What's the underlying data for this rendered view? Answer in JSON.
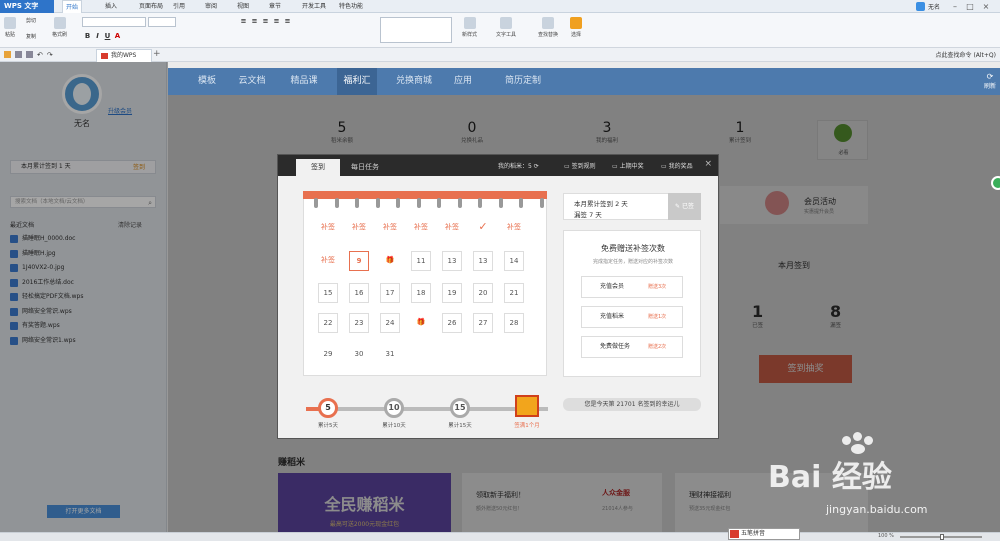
{
  "app": {
    "name": "WPS 文字"
  },
  "menu": [
    "开始",
    "插入",
    "页面布局",
    "引用",
    "审阅",
    "视图",
    "章节",
    "开发工具",
    "特色功能"
  ],
  "user_name_top": "无名",
  "ribbon": {
    "paste": "粘贴",
    "cut": "剪切",
    "copy": "复制",
    "format_painter": "格式刷",
    "new_style": "新样式",
    "text_tools": "文字工具",
    "find_replace": "查找替换",
    "select": "选择"
  },
  "doc_tab": "我的WPS",
  "find_command": "点此查找命令 (Alt+Q)",
  "sidebar": {
    "username": "无名",
    "upgrade_vip": "升级会员",
    "monthly_signed": "本月累计签到 1 天",
    "sign_in_button": "签到",
    "search_placeholder": "搜索文档（本地文档/云文档）",
    "recent_docs_label": "最近文档",
    "clear_records": "清除记录",
    "recent_docs": [
      "描睡眠H_0000.doc",
      "描睡眠H.jpg",
      "1J40VX2-0.jpg",
      "2016工作总结.doc",
      "轻松搞定PDF文档.wps",
      "网络安全常识.wps",
      "有奖答题.wps",
      "网络安全常识1.wps"
    ],
    "open_more": "打开更多文档"
  },
  "nav": {
    "tabs": [
      "模板",
      "云文档",
      "精品课",
      "福利汇",
      "兑换商城",
      "应用",
      "简历定制"
    ],
    "right_icon_label": "刷新"
  },
  "stats": [
    {
      "num": "5",
      "label": "稻米余额"
    },
    {
      "num": "0",
      "label": "兑换礼品"
    },
    {
      "num": "3",
      "label": "我的福利"
    },
    {
      "num": "1",
      "label": "累计签到"
    }
  ],
  "leaf_label": "必看",
  "member_activity": {
    "title": "会员活动",
    "subtitle": "实惠提升会员"
  },
  "monthly_sign": {
    "title": "本月签到",
    "signed_num": "1",
    "signed_label": "已签",
    "missed_num": "8",
    "missed_label": "漏签",
    "lucky_button": "签到抽奖"
  },
  "earn": {
    "header": "赚稻米",
    "banner_title": "全民赚稻米",
    "banner_sub": "最高可送2000元现金红包",
    "card2_title": "领取新手福利！",
    "card2_sub": "额外赠送50元红包！",
    "card2_logo": "人众金服",
    "card2_logo_sub": "21014人参与",
    "card3_title": "理财神接福利",
    "card3_sub": "预送35元现金红包"
  },
  "modal": {
    "tab_signin": "签到",
    "tab_daily": "每日任务",
    "my_rice": "我的稻米：5",
    "sign_rules": "签到规则",
    "last_winners": "上期中奖",
    "my_prizes": "我的奖品",
    "close": "×",
    "calendar": [
      [
        "补签",
        "补签",
        "补签",
        "补签",
        "补签",
        "✓",
        "补签"
      ],
      [
        "补签",
        "9",
        "🎁",
        "11",
        "13",
        "13",
        "14"
      ],
      [
        "15",
        "16",
        "17",
        "18",
        "19",
        "20",
        "21"
      ],
      [
        "22",
        "23",
        "24",
        "🎁",
        "26",
        "27",
        "28"
      ],
      [
        "29",
        "30",
        "31",
        "",
        "",
        "",
        ""
      ]
    ],
    "summary_line1": "本月累计签到 2 天",
    "summary_line2": "漏签 7 天",
    "signed_button": "已签",
    "free_title": "免费赠送补签次数",
    "free_sub": "完成指定任务，赠送对应的补签次数",
    "free_tasks": [
      {
        "label": "充值会员",
        "gift": "赠送3次"
      },
      {
        "label": "充值稻米",
        "gift": "赠送1次"
      },
      {
        "label": "免费做任务",
        "gift": "赠送2次"
      }
    ],
    "milestones": [
      {
        "num": "5",
        "label": "累计5天"
      },
      {
        "num": "10",
        "label": "累计10天"
      },
      {
        "num": "15",
        "label": "累计15天"
      }
    ],
    "chest_label": "签满1个月",
    "lucky_text": "您是今天第 21701 名签到的幸运儿"
  },
  "ime": "五笔拼音",
  "zoom": "100 %",
  "watermark": {
    "brand": "Bai  经验",
    "url": "jingyan.baidu.com"
  }
}
